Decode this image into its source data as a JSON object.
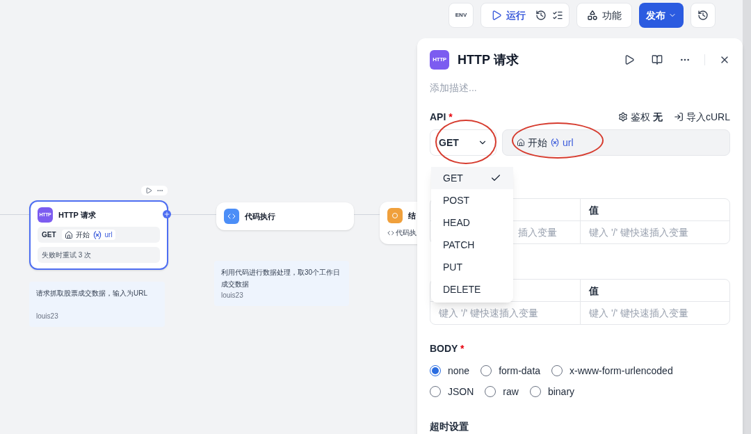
{
  "toolbar": {
    "env": "ENV",
    "run": "运行",
    "features": "功能",
    "publish": "发布"
  },
  "canvas": {
    "nodes": [
      {
        "kind": "http",
        "title": "HTTP 请求",
        "icon_text": "HTTP",
        "method": "GET",
        "source": "开始",
        "variable": "url",
        "retry": "失败时重试 3 次",
        "selected": true,
        "note": "请求抓取股票成交数据，输入为URL",
        "author": "louis23"
      },
      {
        "kind": "code",
        "title": "代码执行",
        "selected": false,
        "note": "利用代码进行数据处理，取30个工作日成交数据",
        "author": "louis23"
      },
      {
        "kind": "end",
        "title": "结",
        "output": "代码执",
        "selected": false
      }
    ]
  },
  "panel": {
    "icon_text": "HTTP",
    "title": "HTTP 请求",
    "description_placeholder": "添加描述...",
    "api_label": "API",
    "api_required": "*",
    "body_required": "*",
    "auth_label": "鉴权",
    "auth_value": "无",
    "import_curl": "导入cURL",
    "method": "GET",
    "url_source": "开始",
    "url_variable": "url",
    "method_menu": [
      {
        "label": "GET",
        "selected": true
      },
      {
        "label": "POST",
        "selected": false
      },
      {
        "label": "HEAD",
        "selected": false
      },
      {
        "label": "PATCH",
        "selected": false
      },
      {
        "label": "PUT",
        "selected": false
      },
      {
        "label": "DELETE",
        "selected": false
      }
    ],
    "tables": [
      {
        "value_header": "值",
        "key_placeholder": "插入变量",
        "value_placeholder": "键入 '/' 键快速插入变量"
      },
      {
        "value_header": "值",
        "key_placeholder": "键入 '/' 键快速插入变量",
        "value_placeholder": "键入 '/' 键快速插入变量"
      }
    ],
    "body_label": "BODY",
    "body_options": [
      {
        "label": "none",
        "selected": true
      },
      {
        "label": "form-data",
        "selected": false
      },
      {
        "label": "x-www-form-urlencoded",
        "selected": false
      },
      {
        "label": "JSON",
        "selected": false
      },
      {
        "label": "raw",
        "selected": false
      },
      {
        "label": "binary",
        "selected": false
      }
    ],
    "timeout_label": "超时设置"
  }
}
